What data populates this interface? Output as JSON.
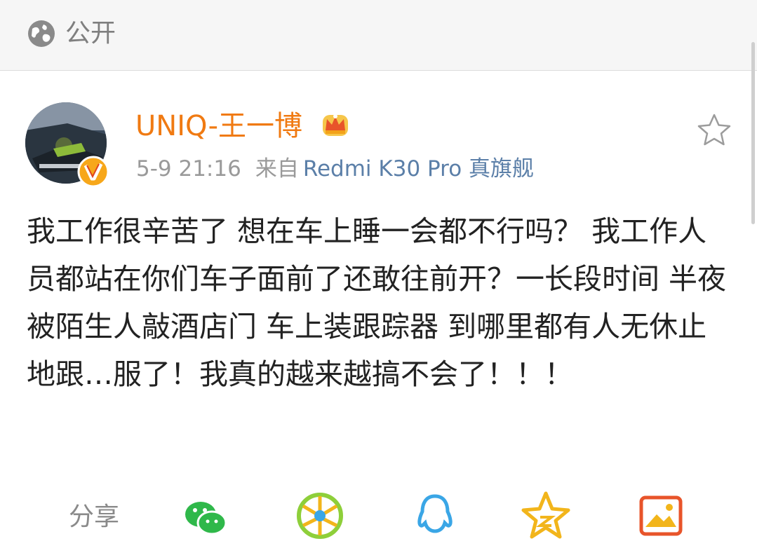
{
  "header": {
    "visibility_label": "公开",
    "visibility_icon": "globe-icon"
  },
  "post": {
    "username": "UNIQ-王一博",
    "verified_badge_icon": "verified-v-icon",
    "member_icon": "crown-icon",
    "time": "5-9 21:16",
    "source_prefix": "来自",
    "source_device": "Redmi K30 Pro 真旗舰",
    "favorite_icon": "star-outline-icon",
    "content": "我工作很辛苦了 想在车上睡一会都不行吗？ 我工作人员都站在你们车子面前了还敢往前开？一长段时间 半夜被陌生人敲酒店门 车上装跟踪器 到哪里都有人无休止地跟…服了！我真的越来越搞不会了！！！"
  },
  "share": {
    "label": "分享",
    "targets": [
      "wechat-icon",
      "moments-icon",
      "qq-icon",
      "qzone-icon",
      "image-icon"
    ]
  },
  "colors": {
    "username": "#f07a12",
    "device_link": "#5b7fa8",
    "share_green": "#2fb84a",
    "share_blue": "#3aa6e6",
    "share_yellow": "#f2b51b"
  }
}
